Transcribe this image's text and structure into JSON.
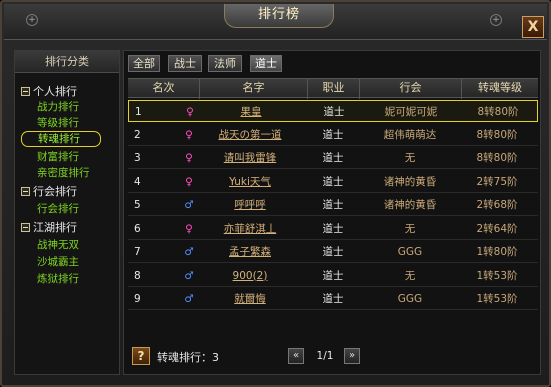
{
  "window": {
    "title": "排行榜",
    "close_label": "X"
  },
  "sidebar": {
    "header": "排行分类",
    "groups": [
      {
        "label": "个人排行",
        "items": [
          "战力排行",
          "等级排行",
          "转魂排行",
          "财富排行",
          "亲密度排行"
        ]
      },
      {
        "label": "行会排行",
        "items": [
          "行会排行"
        ]
      },
      {
        "label": "江湖排行",
        "items": [
          "战神无双",
          "沙城霸主",
          "炼狱排行"
        ]
      }
    ],
    "active_item": "转魂排行"
  },
  "tabs": [
    "全部",
    "战士",
    "法师",
    "道士"
  ],
  "active_tab": "道士",
  "table": {
    "headers": [
      "名次",
      "名字",
      "职业",
      "行会",
      "转魂等级"
    ],
    "rows": [
      {
        "rank": "1",
        "gender": "female",
        "name": "果皇",
        "job": "道士",
        "guild": "妮可妮可妮",
        "level": "8转80阶"
      },
      {
        "rank": "2",
        "gender": "female",
        "name": "战天の第一道",
        "job": "道士",
        "guild": "超伟萌萌达",
        "level": "8转80阶"
      },
      {
        "rank": "3",
        "gender": "female",
        "name": "请叫我雷锋",
        "job": "道士",
        "guild": "无",
        "level": "8转80阶"
      },
      {
        "rank": "4",
        "gender": "female",
        "name": "Yuki天气",
        "job": "道士",
        "guild": "诸神的黄昏",
        "level": "2转75阶"
      },
      {
        "rank": "5",
        "gender": "male",
        "name": "呼呼呼",
        "job": "道士",
        "guild": "诸神的黄昏",
        "level": "2转68阶"
      },
      {
        "rank": "6",
        "gender": "female",
        "name": "亦菲舒淇丄",
        "job": "道士",
        "guild": "无",
        "level": "2转64阶"
      },
      {
        "rank": "7",
        "gender": "male",
        "name": "孟子繁森",
        "job": "道士",
        "guild": "GGG",
        "level": "1转80阶"
      },
      {
        "rank": "8",
        "gender": "male",
        "name": "900(2)",
        "job": "道士",
        "guild": "无",
        "level": "1转53阶"
      },
      {
        "rank": "9",
        "gender": "male",
        "name": "就爾悔",
        "job": "道士",
        "guild": "GGG",
        "level": "1转53阶"
      }
    ],
    "selected_rank": "1"
  },
  "footer": {
    "help_label": "?",
    "label": "转魂排行：3",
    "page": "1/1",
    "prev_label": "«",
    "next_label": "»"
  },
  "colors": {
    "female": "#ff4fbf",
    "male": "#4f8fff",
    "highlight": "#e4d22a"
  }
}
